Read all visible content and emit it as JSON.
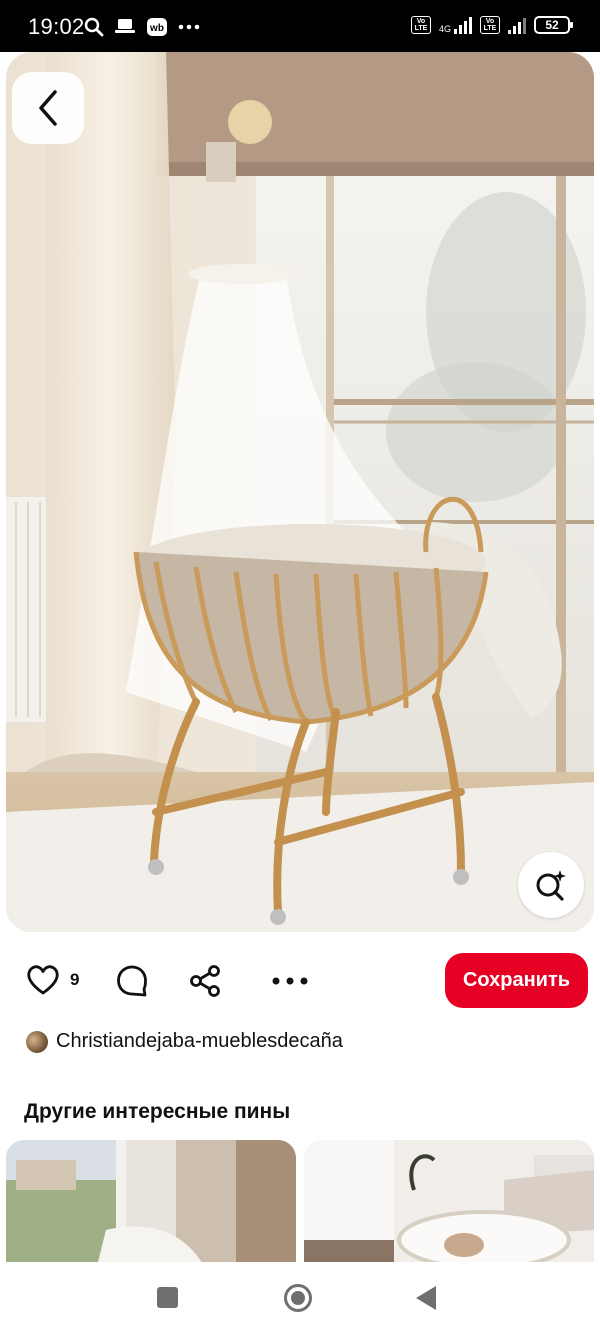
{
  "status": {
    "time": "19:02",
    "network": "4G",
    "battery": "52",
    "volte1": "Vo LTE",
    "volte2": "Vo LTE"
  },
  "pin": {
    "like_count": "9",
    "save_label": "Сохранить",
    "author": "Christiandejaba-mueblesdecaña"
  },
  "related": {
    "title": "Другие интересные пины"
  },
  "icons": {
    "back": "chevron-left-icon",
    "lens": "visual-search-icon",
    "like": "heart-icon",
    "comment": "comment-icon",
    "share": "share-icon",
    "more": "more-icon"
  },
  "colors": {
    "save_button": "#e60023"
  }
}
